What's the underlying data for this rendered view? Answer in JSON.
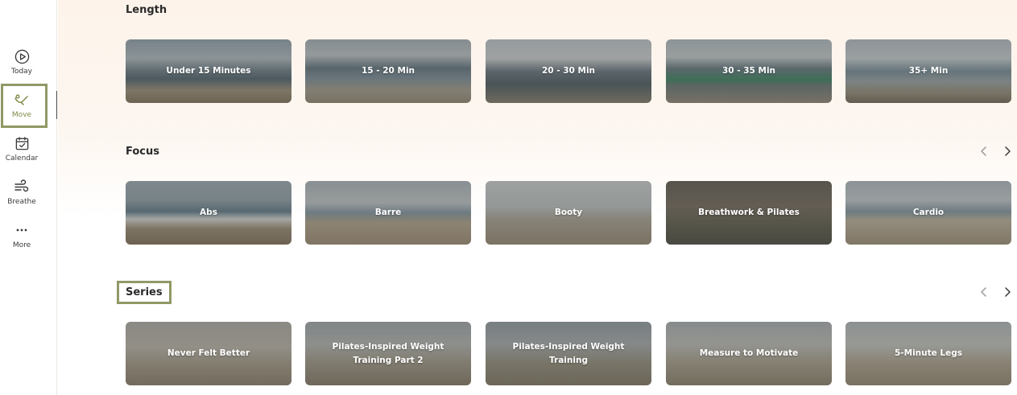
{
  "sidebar": {
    "items": [
      {
        "label": "Today",
        "icon": "play-circle-icon"
      },
      {
        "label": "Move",
        "icon": "move-icon"
      },
      {
        "label": "Calendar",
        "icon": "calendar-check-icon"
      },
      {
        "label": "Breathe",
        "icon": "wind-icon"
      },
      {
        "label": "More",
        "icon": "more-dots-icon"
      }
    ],
    "active": "Move"
  },
  "sections": {
    "length": {
      "title": "Length",
      "cards": [
        "Under 15 Minutes",
        "15 - 20 Min",
        "20 - 30 Min",
        "30 - 35 Min",
        "35+ Min"
      ]
    },
    "focus": {
      "title": "Focus",
      "cards": [
        "Abs",
        "Barre",
        "Booty",
        "Breathwork & Pilates",
        "Cardio"
      ]
    },
    "series": {
      "title": "Series",
      "cards": [
        "Never Felt Better",
        "Pilates-Inspired Weight Training Part 2",
        "Pilates-Inspired Weight Training",
        "Measure to Motivate",
        "5-Minute Legs"
      ]
    }
  },
  "colors": {
    "accent": "#7d8a45",
    "highlight_box": "#8f9966",
    "card_text": "#ffffff"
  }
}
